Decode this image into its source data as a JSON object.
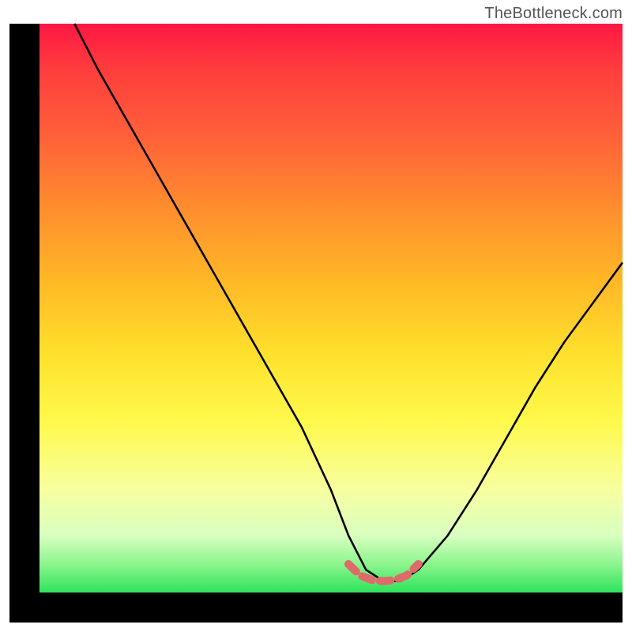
{
  "watermark": "TheBottleneck.com",
  "chart_data": {
    "type": "line",
    "title": "",
    "xlabel": "",
    "ylabel": "",
    "xlim": [
      0,
      100
    ],
    "ylim": [
      0,
      100
    ],
    "series": [
      {
        "name": "bottleneck-curve",
        "color": "#000000",
        "x": [
          6,
          10,
          15,
          20,
          25,
          30,
          35,
          40,
          45,
          50,
          53,
          56,
          59,
          62,
          65,
          70,
          75,
          80,
          85,
          90,
          95,
          100
        ],
        "values": [
          100,
          92,
          83,
          74,
          65,
          56,
          47,
          38,
          29,
          18,
          10,
          4,
          2,
          2,
          4,
          10,
          18,
          27,
          36,
          44,
          51,
          58
        ]
      },
      {
        "name": "optimal-zone",
        "color": "#e06a6a",
        "x": [
          53,
          55,
          57,
          59,
          61,
          63,
          65
        ],
        "values": [
          5,
          3,
          2.2,
          2,
          2.2,
          3,
          5
        ]
      }
    ],
    "gradient_stops": [
      {
        "pos": 0,
        "color": "#ff1744"
      },
      {
        "pos": 8,
        "color": "#ff3d3d"
      },
      {
        "pos": 18,
        "color": "#ff5a3a"
      },
      {
        "pos": 32,
        "color": "#ff8c2e"
      },
      {
        "pos": 45,
        "color": "#ffb726"
      },
      {
        "pos": 58,
        "color": "#ffe02c"
      },
      {
        "pos": 70,
        "color": "#fff94c"
      },
      {
        "pos": 82,
        "color": "#f7ffa0"
      },
      {
        "pos": 90,
        "color": "#d8ffc0"
      },
      {
        "pos": 95,
        "color": "#8cf58d"
      },
      {
        "pos": 100,
        "color": "#2ee35c"
      }
    ]
  }
}
